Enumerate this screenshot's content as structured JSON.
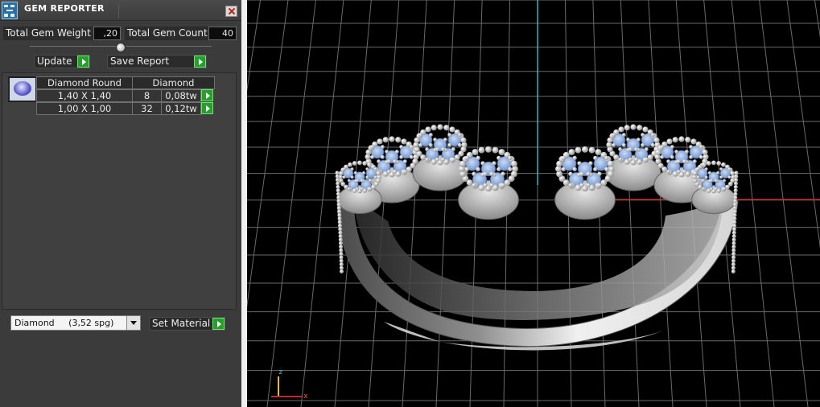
{
  "window": {
    "title": "GEM REPORTER"
  },
  "summary": {
    "total_weight_label": "Total Gem Weight",
    "total_weight_value": ",20",
    "total_count_label": "Total Gem Count",
    "total_count_value": "40"
  },
  "actions": {
    "update_label": "Update",
    "save_report_label": "Save Report"
  },
  "gem_table": {
    "columns": [
      "Diamond Round",
      "Diamond"
    ],
    "rows": [
      {
        "size": "1,40 X 1,40",
        "count": "8",
        "weight": "0,08tw"
      },
      {
        "size": "1,00 X 1,00",
        "count": "32",
        "weight": "0,12tw"
      }
    ]
  },
  "material": {
    "selected": "Diamond     (3,52 spg)",
    "set_label": "Set Material"
  },
  "viewport": {
    "axis_labels": {
      "x": "x",
      "z": "z"
    },
    "colors": {
      "background": "#000000",
      "grid": "#6a6a6a",
      "metal": "#c8c8c8",
      "gem": "#7fa3d9",
      "axis_x": "#c2282a",
      "axis_y": "#2bb5c8"
    }
  }
}
